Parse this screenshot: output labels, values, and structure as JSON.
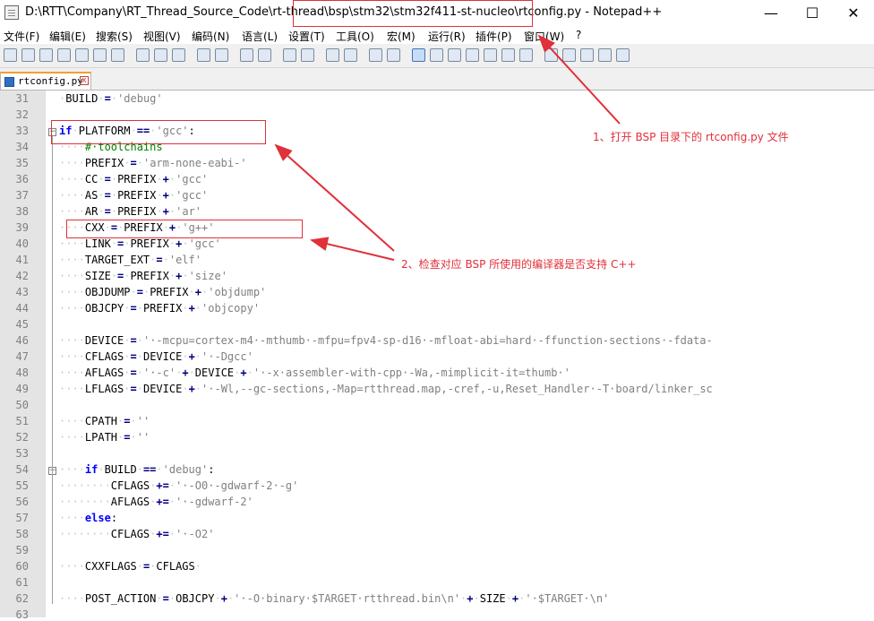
{
  "window": {
    "title": "D:\\RTT\\Company\\RT_Thread_Source_Code\\rt-thread\\bsp\\stm32\\stm32f411-st-nucleo\\rtconfig.py - Notepad++",
    "minimize": "—",
    "maximize": "☐",
    "close": "✕"
  },
  "menu": [
    "文件(F)",
    "编辑(E)",
    "搜索(S)",
    "视图(V)",
    "编码(N)",
    "语言(L)",
    "设置(T)",
    "工具(O)",
    "宏(M)",
    "运行(R)",
    "插件(P)",
    "窗口(W)",
    "?"
  ],
  "tab": {
    "label": "rtconfig.py",
    "close": "x"
  },
  "code_lines": [
    {
      "n": "31",
      "html": "<span class='ws'>·</span>BUILD<span class='ws'>·</span><span class='op'>=</span><span class='ws'>·</span><span class='st'>'debug'</span>"
    },
    {
      "n": "32",
      "html": ""
    },
    {
      "n": "33",
      "html": "<span class='kw'>if</span><span class='ws'>·</span>PLATFORM<span class='ws'>·</span><span class='op'>==</span><span class='ws'>·</span><span class='st'>'gcc'</span>:"
    },
    {
      "n": "34",
      "html": "<span class='ws'>····</span><span class='cm'>#·toolchains</span>"
    },
    {
      "n": "35",
      "html": "<span class='ws'>····</span>PREFIX<span class='ws'>·</span><span class='op'>=</span><span class='ws'>·</span><span class='st'>'arm-none-eabi-'</span>"
    },
    {
      "n": "36",
      "html": "<span class='ws'>····</span>CC<span class='ws'>·</span><span class='op'>=</span><span class='ws'>·</span>PREFIX<span class='ws'>·</span><span class='op'>+</span><span class='ws'>·</span><span class='st'>'gcc'</span>"
    },
    {
      "n": "37",
      "html": "<span class='ws'>····</span>AS<span class='ws'>·</span><span class='op'>=</span><span class='ws'>·</span>PREFIX<span class='ws'>·</span><span class='op'>+</span><span class='ws'>·</span><span class='st'>'gcc'</span>"
    },
    {
      "n": "38",
      "html": "<span class='ws'>····</span>AR<span class='ws'>·</span><span class='op'>=</span><span class='ws'>·</span>PREFIX<span class='ws'>·</span><span class='op'>+</span><span class='ws'>·</span><span class='st'>'ar'</span>"
    },
    {
      "n": "39",
      "html": "<span class='ws'>····</span>CXX<span class='ws'>·</span><span class='op'>=</span><span class='ws'>·</span>PREFIX<span class='ws'>·</span><span class='op'>+</span><span class='ws'>·</span><span class='st'>'g++'</span>"
    },
    {
      "n": "40",
      "html": "<span class='ws'>····</span>LINK<span class='ws'>·</span><span class='op'>=</span><span class='ws'>·</span>PREFIX<span class='ws'>·</span><span class='op'>+</span><span class='ws'>·</span><span class='st'>'gcc'</span>"
    },
    {
      "n": "41",
      "html": "<span class='ws'>····</span>TARGET_EXT<span class='ws'>·</span><span class='op'>=</span><span class='ws'>·</span><span class='st'>'elf'</span>"
    },
    {
      "n": "42",
      "html": "<span class='ws'>····</span>SIZE<span class='ws'>·</span><span class='op'>=</span><span class='ws'>·</span>PREFIX<span class='ws'>·</span><span class='op'>+</span><span class='ws'>·</span><span class='st'>'size'</span>"
    },
    {
      "n": "43",
      "html": "<span class='ws'>····</span>OBJDUMP<span class='ws'>·</span><span class='op'>=</span><span class='ws'>·</span>PREFIX<span class='ws'>·</span><span class='op'>+</span><span class='ws'>·</span><span class='st'>'objdump'</span>"
    },
    {
      "n": "44",
      "html": "<span class='ws'>····</span>OBJCPY<span class='ws'>·</span><span class='op'>=</span><span class='ws'>·</span>PREFIX<span class='ws'>·</span><span class='op'>+</span><span class='ws'>·</span><span class='st'>'objcopy'</span>"
    },
    {
      "n": "45",
      "html": ""
    },
    {
      "n": "46",
      "html": "<span class='ws'>····</span>DEVICE<span class='ws'>·</span><span class='op'>=</span><span class='ws'>·</span><span class='st'>'·-mcpu=cortex-m4·-mthumb·-mfpu=fpv4-sp-d16·-mfloat-abi=hard·-ffunction-sections·-fdata-</span>"
    },
    {
      "n": "47",
      "html": "<span class='ws'>····</span>CFLAGS<span class='ws'>·</span><span class='op'>=</span><span class='ws'>·</span>DEVICE<span class='ws'>·</span><span class='op'>+</span><span class='ws'>·</span><span class='st'>'·-Dgcc'</span>"
    },
    {
      "n": "48",
      "html": "<span class='ws'>····</span>AFLAGS<span class='ws'>·</span><span class='op'>=</span><span class='ws'>·</span><span class='st'>'·-c'</span><span class='ws'>·</span><span class='op'>+</span><span class='ws'>·</span>DEVICE<span class='ws'>·</span><span class='op'>+</span><span class='ws'>·</span><span class='st'>'·-x·assembler-with-cpp·-Wa,-mimplicit-it=thumb·'</span>"
    },
    {
      "n": "49",
      "html": "<span class='ws'>····</span>LFLAGS<span class='ws'>·</span><span class='op'>=</span><span class='ws'>·</span>DEVICE<span class='ws'>·</span><span class='op'>+</span><span class='ws'>·</span><span class='st'>'·-Wl,--gc-sections,-Map=rtthread.map,-cref,-u,Reset_Handler·-T·board/linker_sc</span>"
    },
    {
      "n": "50",
      "html": ""
    },
    {
      "n": "51",
      "html": "<span class='ws'>····</span>CPATH<span class='ws'>·</span><span class='op'>=</span><span class='ws'>·</span><span class='st'>''</span>"
    },
    {
      "n": "52",
      "html": "<span class='ws'>····</span>LPATH<span class='ws'>·</span><span class='op'>=</span><span class='ws'>·</span><span class='st'>''</span>"
    },
    {
      "n": "53",
      "html": ""
    },
    {
      "n": "54",
      "html": "<span class='ws'>····</span><span class='kw'>if</span><span class='ws'>·</span>BUILD<span class='ws'>·</span><span class='op'>==</span><span class='ws'>·</span><span class='st'>'debug'</span>:"
    },
    {
      "n": "55",
      "html": "<span class='ws'>········</span>CFLAGS<span class='ws'>·</span><span class='op'>+=</span><span class='ws'>·</span><span class='st'>'·-O0·-gdwarf-2·-g'</span>"
    },
    {
      "n": "56",
      "html": "<span class='ws'>········</span>AFLAGS<span class='ws'>·</span><span class='op'>+=</span><span class='ws'>·</span><span class='st'>'·-gdwarf-2'</span>"
    },
    {
      "n": "57",
      "html": "<span class='ws'>····</span><span class='kw'>else</span>:"
    },
    {
      "n": "58",
      "html": "<span class='ws'>········</span>CFLAGS<span class='ws'>·</span><span class='op'>+=</span><span class='ws'>·</span><span class='st'>'·-O2'</span>"
    },
    {
      "n": "59",
      "html": ""
    },
    {
      "n": "60",
      "html": "<span class='ws'>····</span>CXXFLAGS<span class='ws'>·</span><span class='op'>=</span><span class='ws'>·</span>CFLAGS<span class='ws'>·</span>"
    },
    {
      "n": "61",
      "html": ""
    },
    {
      "n": "62",
      "html": "<span class='ws'>····</span>POST_ACTION<span class='ws'>·</span><span class='op'>=</span><span class='ws'>·</span>OBJCPY<span class='ws'>·</span><span class='op'>+</span><span class='ws'>·</span><span class='st'>'·-O·binary·$TARGET·rtthread.bin\\n'</span><span class='ws'>·</span><span class='op'>+</span><span class='ws'>·</span>SIZE<span class='ws'>·</span><span class='op'>+</span><span class='ws'>·</span><span class='st'>'·$TARGET·\\n'</span>"
    },
    {
      "n": "63",
      "html": ""
    }
  ],
  "annotations": {
    "step1": "1、打开 BSP 目录下的 rtconfig.py 文件",
    "step2": "2、检查对应 BSP 所使用的编译器是否支持 C++"
  },
  "colors": {
    "annotation": "#e0303a",
    "keyword": "#0000ff",
    "string": "#808080",
    "comment": "#008000"
  }
}
